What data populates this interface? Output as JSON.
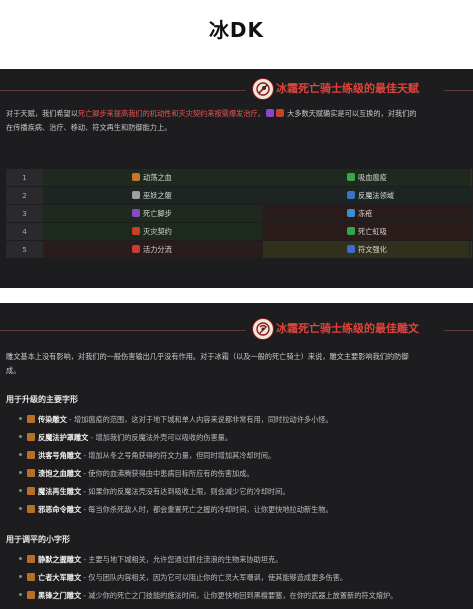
{
  "page_title": "冰DK",
  "talent_section": {
    "title": "冰霜死亡骑士练级的最佳天赋",
    "intro_p1": "对于天赋，我们希望以",
    "intro_highlight_red": "死亡脚步来提高我们的机动性和灭灾契约来按需爆发治疗。",
    "intro_p2": "大多数天赋确实是可以互换的，对我们的",
    "intro_line2": "在传播疾病、治疗、移动、符文再生和防御能力上。",
    "rows": [
      {
        "level": "1",
        "a": "动荡之血",
        "b": "吸血瘟疫",
        "a_color": "#c9762a",
        "b_color": "#3aa64a"
      },
      {
        "level": "2",
        "a": "巫妖之躯",
        "b": "反魔法领域",
        "a_color": "#a0a0a0",
        "b_color": "#3a74c9"
      },
      {
        "level": "3",
        "a": "死亡脚步",
        "b": "冻疮",
        "a_color": "#8a48c9",
        "b_color": "#3a8ed1"
      },
      {
        "level": "4",
        "a": "灭灾契约",
        "b": "死亡虹吸",
        "a_color": "#c8402a",
        "b_color": "#2fa650"
      },
      {
        "level": "5",
        "a": "活力分流",
        "b": "符文强化",
        "a_color": "#c93a3a",
        "b_color": "#3a6cc9"
      }
    ]
  },
  "glyph_section": {
    "title": "冰霜死亡骑士练级的最佳雕文",
    "intro_line1": "雕文基本上没有影响，对我们的一般伤害输出几乎没有作用。对于冰霜（以及一般的死亡骑士）来说，雕文主要影响我们的防御",
    "intro_line2": "成。",
    "major_heading": "用于升级的主要字形",
    "major_glyphs": [
      {
        "name": "传染雕文",
        "desc": " - 增加瘟疫的范围，这对于地下城和单人内容来说都非常有用，同时拉动许多小怪。"
      },
      {
        "name": "反魔法护罩雕文",
        "desc": " - 增加我们的反魔法外壳可以吸收的伤害量。"
      },
      {
        "name": "洪客号角雕文",
        "desc": " - 增加从冬之号角获得的符文力量，但同时增加其冷却时间。"
      },
      {
        "name": "溃饱之血雕文",
        "desc": " - 使你的血沸腾获得由中患病目标所应有的伤害加成。"
      },
      {
        "name": "魔法再生雕文",
        "desc": " - 如果你的反魔法壳没有达到吸收上限，则会减少它的冷却时间。"
      },
      {
        "name": "邪恶命令雕文",
        "desc": " - 每当你杀死敌人时，都会重置死亡之握的冷却时间，让你更快地拉动新生物。"
      }
    ],
    "minor_heading": "用于调平的小字形",
    "minor_glyphs": [
      {
        "name": "静默之握雕文",
        "desc": " - 主要与地下城相关，允许您通过抓住流浪的生物来协助坦克。"
      },
      {
        "name": "亡者大军雕文",
        "desc": " - 仅与团队内容相关，因为它可以阻止你的亡灵大军嘲讽，使其能够造成更多伤害。"
      },
      {
        "name": "黑锋之门雕文",
        "desc": " - 减少你的死亡之门技能的施法时间，让你更快地回到黑檀要塞，在你的武器上放置新的符文熔炉。"
      }
    ]
  }
}
